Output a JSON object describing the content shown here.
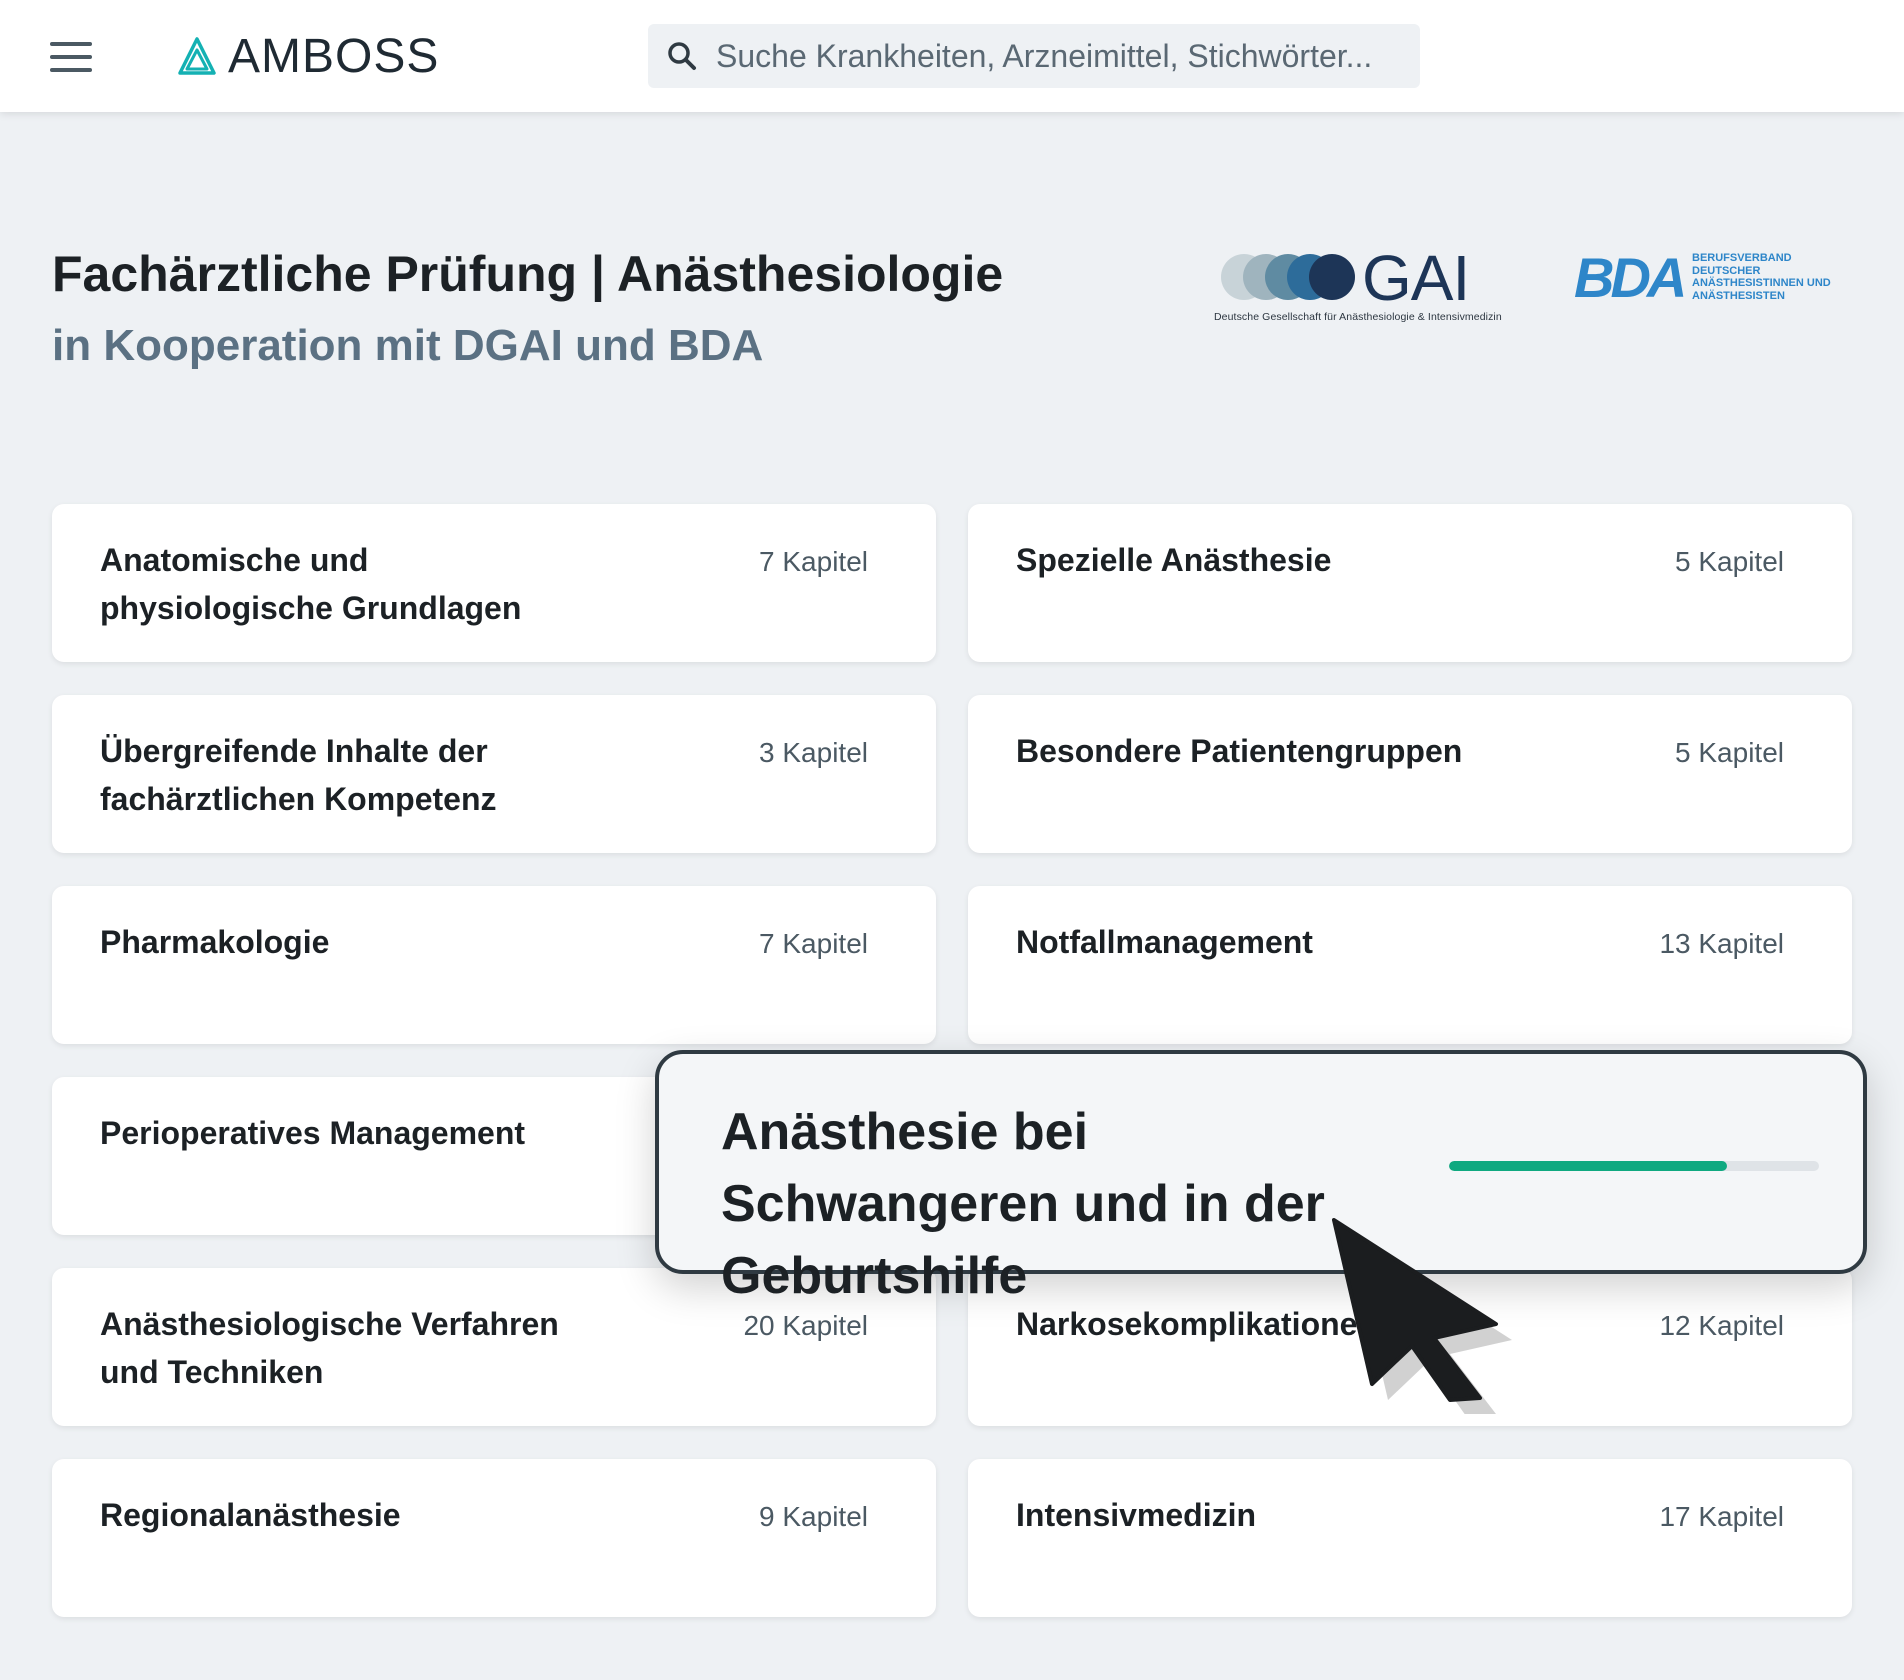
{
  "header": {
    "logo_text": "AMBOSS",
    "search_placeholder": "Suche Krankheiten, Arzneimittel, Stichwörter..."
  },
  "page": {
    "title": "Fachärztliche Prüfung | Anästhesiologie",
    "subtitle": "in Kooperation mit DGAI und BDA"
  },
  "partners": {
    "dgai_letters": "GAI",
    "dgai_caption": "Deutsche Gesellschaft für Anästhesiologie & Intensivmedizin",
    "bda_mark": "BDA",
    "bda_text": "BERUFSVERBAND DEUTSCHER ANÄSTHESISTINNEN UND ANÄSTHESISTEN"
  },
  "cards": [
    {
      "title": "Anatomische und physiologische Grundlagen",
      "count": "7 Kapitel"
    },
    {
      "title": "Spezielle Anästhesie",
      "count": "5 Kapitel"
    },
    {
      "title": "Übergreifende Inhalte der fachärztlichen Kompetenz",
      "count": "3 Kapitel"
    },
    {
      "title": "Besondere Patientengruppen",
      "count": "5 Kapitel"
    },
    {
      "title": "Pharmakologie",
      "count": "7 Kapitel"
    },
    {
      "title": "Notfallmanagement",
      "count": "13 Kapitel"
    },
    {
      "title": "Perioperatives Management",
      "count": ""
    },
    {
      "title": "",
      "count": ""
    },
    {
      "title": "Anästhesiologische Verfahren und Techniken",
      "count": "20 Kapitel"
    },
    {
      "title": "Narkosekomplikationen",
      "count": "12 Kapitel"
    },
    {
      "title": "Regionalanästhesie",
      "count": "9 Kapitel"
    },
    {
      "title": "Intensivmedizin",
      "count": "17 Kapitel"
    }
  ],
  "highlight": {
    "title": "Anästhesie bei Schwangeren und in der Geburtshilfe",
    "progress": 0.75,
    "progress_color": "#0fa980"
  },
  "colors": {
    "background": "#eef1f4",
    "accent": "#0fa980",
    "subtitle": "#5b7183",
    "brand_teal": "#14b1b3"
  },
  "icons": {
    "menu": "hamburger-menu-icon",
    "logo": "amboss-triangle-logo-icon",
    "search": "search-icon",
    "cursor": "mouse-pointer-icon"
  }
}
